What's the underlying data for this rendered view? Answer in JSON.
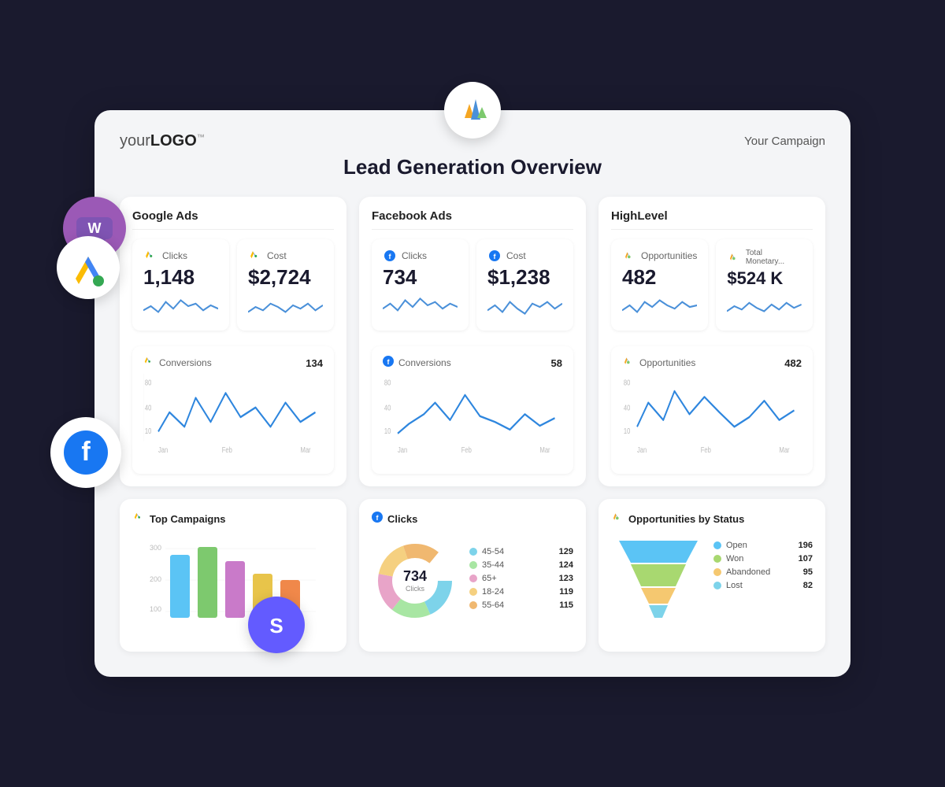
{
  "header": {
    "logo": "yourLOGO™",
    "campaign": "Your Campaign",
    "title": "Lead Generation Overview"
  },
  "sections": {
    "google": {
      "title": "Google Ads",
      "metrics": [
        {
          "label": "Clicks",
          "value": "1,148",
          "icon": "google-ads-icon"
        },
        {
          "label": "Cost",
          "value": "$2,724",
          "icon": "google-ads-icon"
        }
      ],
      "chart": {
        "label": "Conversions",
        "value": "134",
        "yLabels": [
          "80",
          "40",
          "10"
        ],
        "xLabels": [
          "Jan",
          "Feb",
          "Mar"
        ]
      }
    },
    "facebook": {
      "title": "Facebook Ads",
      "metrics": [
        {
          "label": "Clicks",
          "value": "734",
          "icon": "facebook-icon"
        },
        {
          "label": "Cost",
          "value": "$1,238",
          "icon": "facebook-icon"
        }
      ],
      "chart": {
        "label": "Conversions",
        "value": "58",
        "yLabels": [
          "80",
          "40",
          "10"
        ],
        "xLabels": [
          "Jan",
          "Feb",
          "Mar"
        ]
      }
    },
    "highlevel": {
      "title": "HighLevel",
      "metrics": [
        {
          "label": "Opportunities",
          "value": "482",
          "icon": "highlevel-icon"
        },
        {
          "label": "Total Monetary...",
          "value": "$524 K",
          "icon": "highlevel-icon"
        }
      ],
      "chart": {
        "label": "Opportunities",
        "value": "482",
        "yLabels": [
          "80",
          "40",
          "10"
        ],
        "xLabels": [
          "Jan",
          "Feb",
          "Mar"
        ]
      }
    }
  },
  "bottom": {
    "topCampaigns": {
      "title": "Top Campaigns",
      "yLabels": [
        "300",
        "200",
        "100"
      ],
      "bars": [
        {
          "color": "#5bc4f5",
          "height": 0.7
        },
        {
          "color": "#7dc96e",
          "height": 0.85
        },
        {
          "color": "#c97ac9",
          "height": 0.6
        },
        {
          "color": "#e8c44a",
          "height": 0.45
        },
        {
          "color": "#f0884a",
          "height": 0.38
        }
      ]
    },
    "fbClicks": {
      "title": "Clicks",
      "center": "734",
      "centerSub": "Clicks",
      "segments": [
        {
          "label": "45-54",
          "value": "129",
          "color": "#7dd3ea"
        },
        {
          "label": "35-44",
          "value": "124",
          "color": "#a8e6a3"
        },
        {
          "label": "65+",
          "value": "123",
          "color": "#e8a4c8"
        },
        {
          "label": "18-24",
          "value": "119",
          "color": "#f5d080"
        },
        {
          "label": "55-64",
          "value": "115",
          "color": "#f0b870"
        }
      ]
    },
    "opsByStatus": {
      "title": "Opportunities by Status",
      "items": [
        {
          "label": "Open",
          "value": "196",
          "color": "#5bc4f5"
        },
        {
          "label": "Won",
          "value": "107",
          "color": "#a8d870"
        },
        {
          "label": "Abandoned",
          "value": "95",
          "color": "#f5c870"
        },
        {
          "label": "Lost",
          "value": "82",
          "color": "#5bc4f5"
        }
      ]
    }
  }
}
